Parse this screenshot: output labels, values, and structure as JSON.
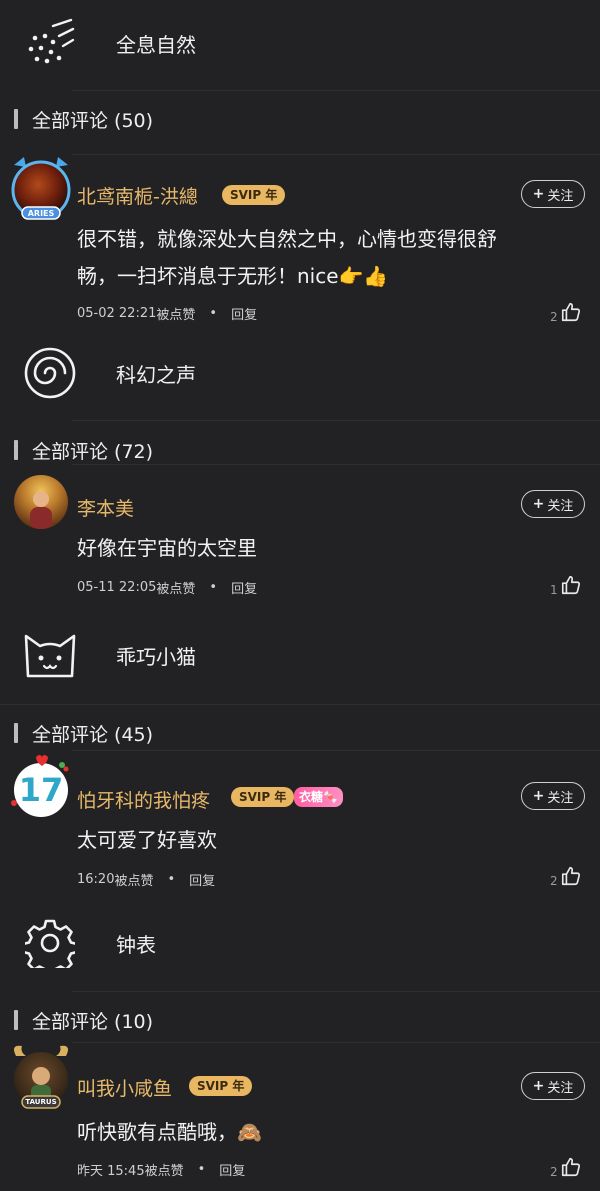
{
  "sounds": [
    {
      "icon": "sparkle-particles-icon",
      "label": "全息自然",
      "section_title": "全部评论 (50)",
      "comment": {
        "username": "北鸢南栀-洪總",
        "badge": "SVIP 年",
        "badge2": "",
        "follow_label": "关注",
        "text_line1": "很不错，就像深处大自然之中，心情也变得很舒",
        "text_line2": "畅，一扫坏消息于无形！nice👉👍",
        "time": "05-02 22:21",
        "liked_by": "被点赞",
        "reply_label": "回复",
        "like_count": "2",
        "avatar_caption": "ARIES"
      }
    },
    {
      "icon": "spiral-icon",
      "label": "科幻之声",
      "section_title": "全部评论 (72)",
      "comment": {
        "username": "李本美",
        "badge": "",
        "badge2": "",
        "follow_label": "关注",
        "text_line1": "好像在宇宙的太空里",
        "text_line2": "",
        "time": "05-11 22:05",
        "liked_by": "被点赞",
        "reply_label": "回复",
        "like_count": "1",
        "avatar_caption": ""
      }
    },
    {
      "icon": "cat-face-icon",
      "label": "乖巧小猫",
      "section_title": "全部评论 (45)",
      "comment": {
        "username": "怕牙科的我怕疼",
        "badge": "SVIP 年",
        "badge2": "衣糖🍬",
        "follow_label": "关注",
        "text_line1": "太可爱了好喜欢",
        "text_line2": "",
        "time": "16:20",
        "liked_by": "被点赞",
        "reply_label": "回复",
        "like_count": "2",
        "avatar_caption": "17"
      }
    },
    {
      "icon": "gear-icon",
      "label": "钟表",
      "section_title": "全部评论 (10)",
      "comment": {
        "username": "叫我小咸鱼",
        "badge": "SVIP 年",
        "badge2": "",
        "follow_label": "关注",
        "text_line1": "听快歌有点酷哦，🙈",
        "text_line2": "",
        "time": "昨天 15:45",
        "liked_by": "被点赞",
        "reply_label": "回复",
        "like_count": "2",
        "avatar_caption": "TAURUS"
      }
    }
  ],
  "colors": {
    "background": "#222224",
    "username": "#e7b86a",
    "badge": "#e9b661",
    "divider": "#2e2e31"
  }
}
